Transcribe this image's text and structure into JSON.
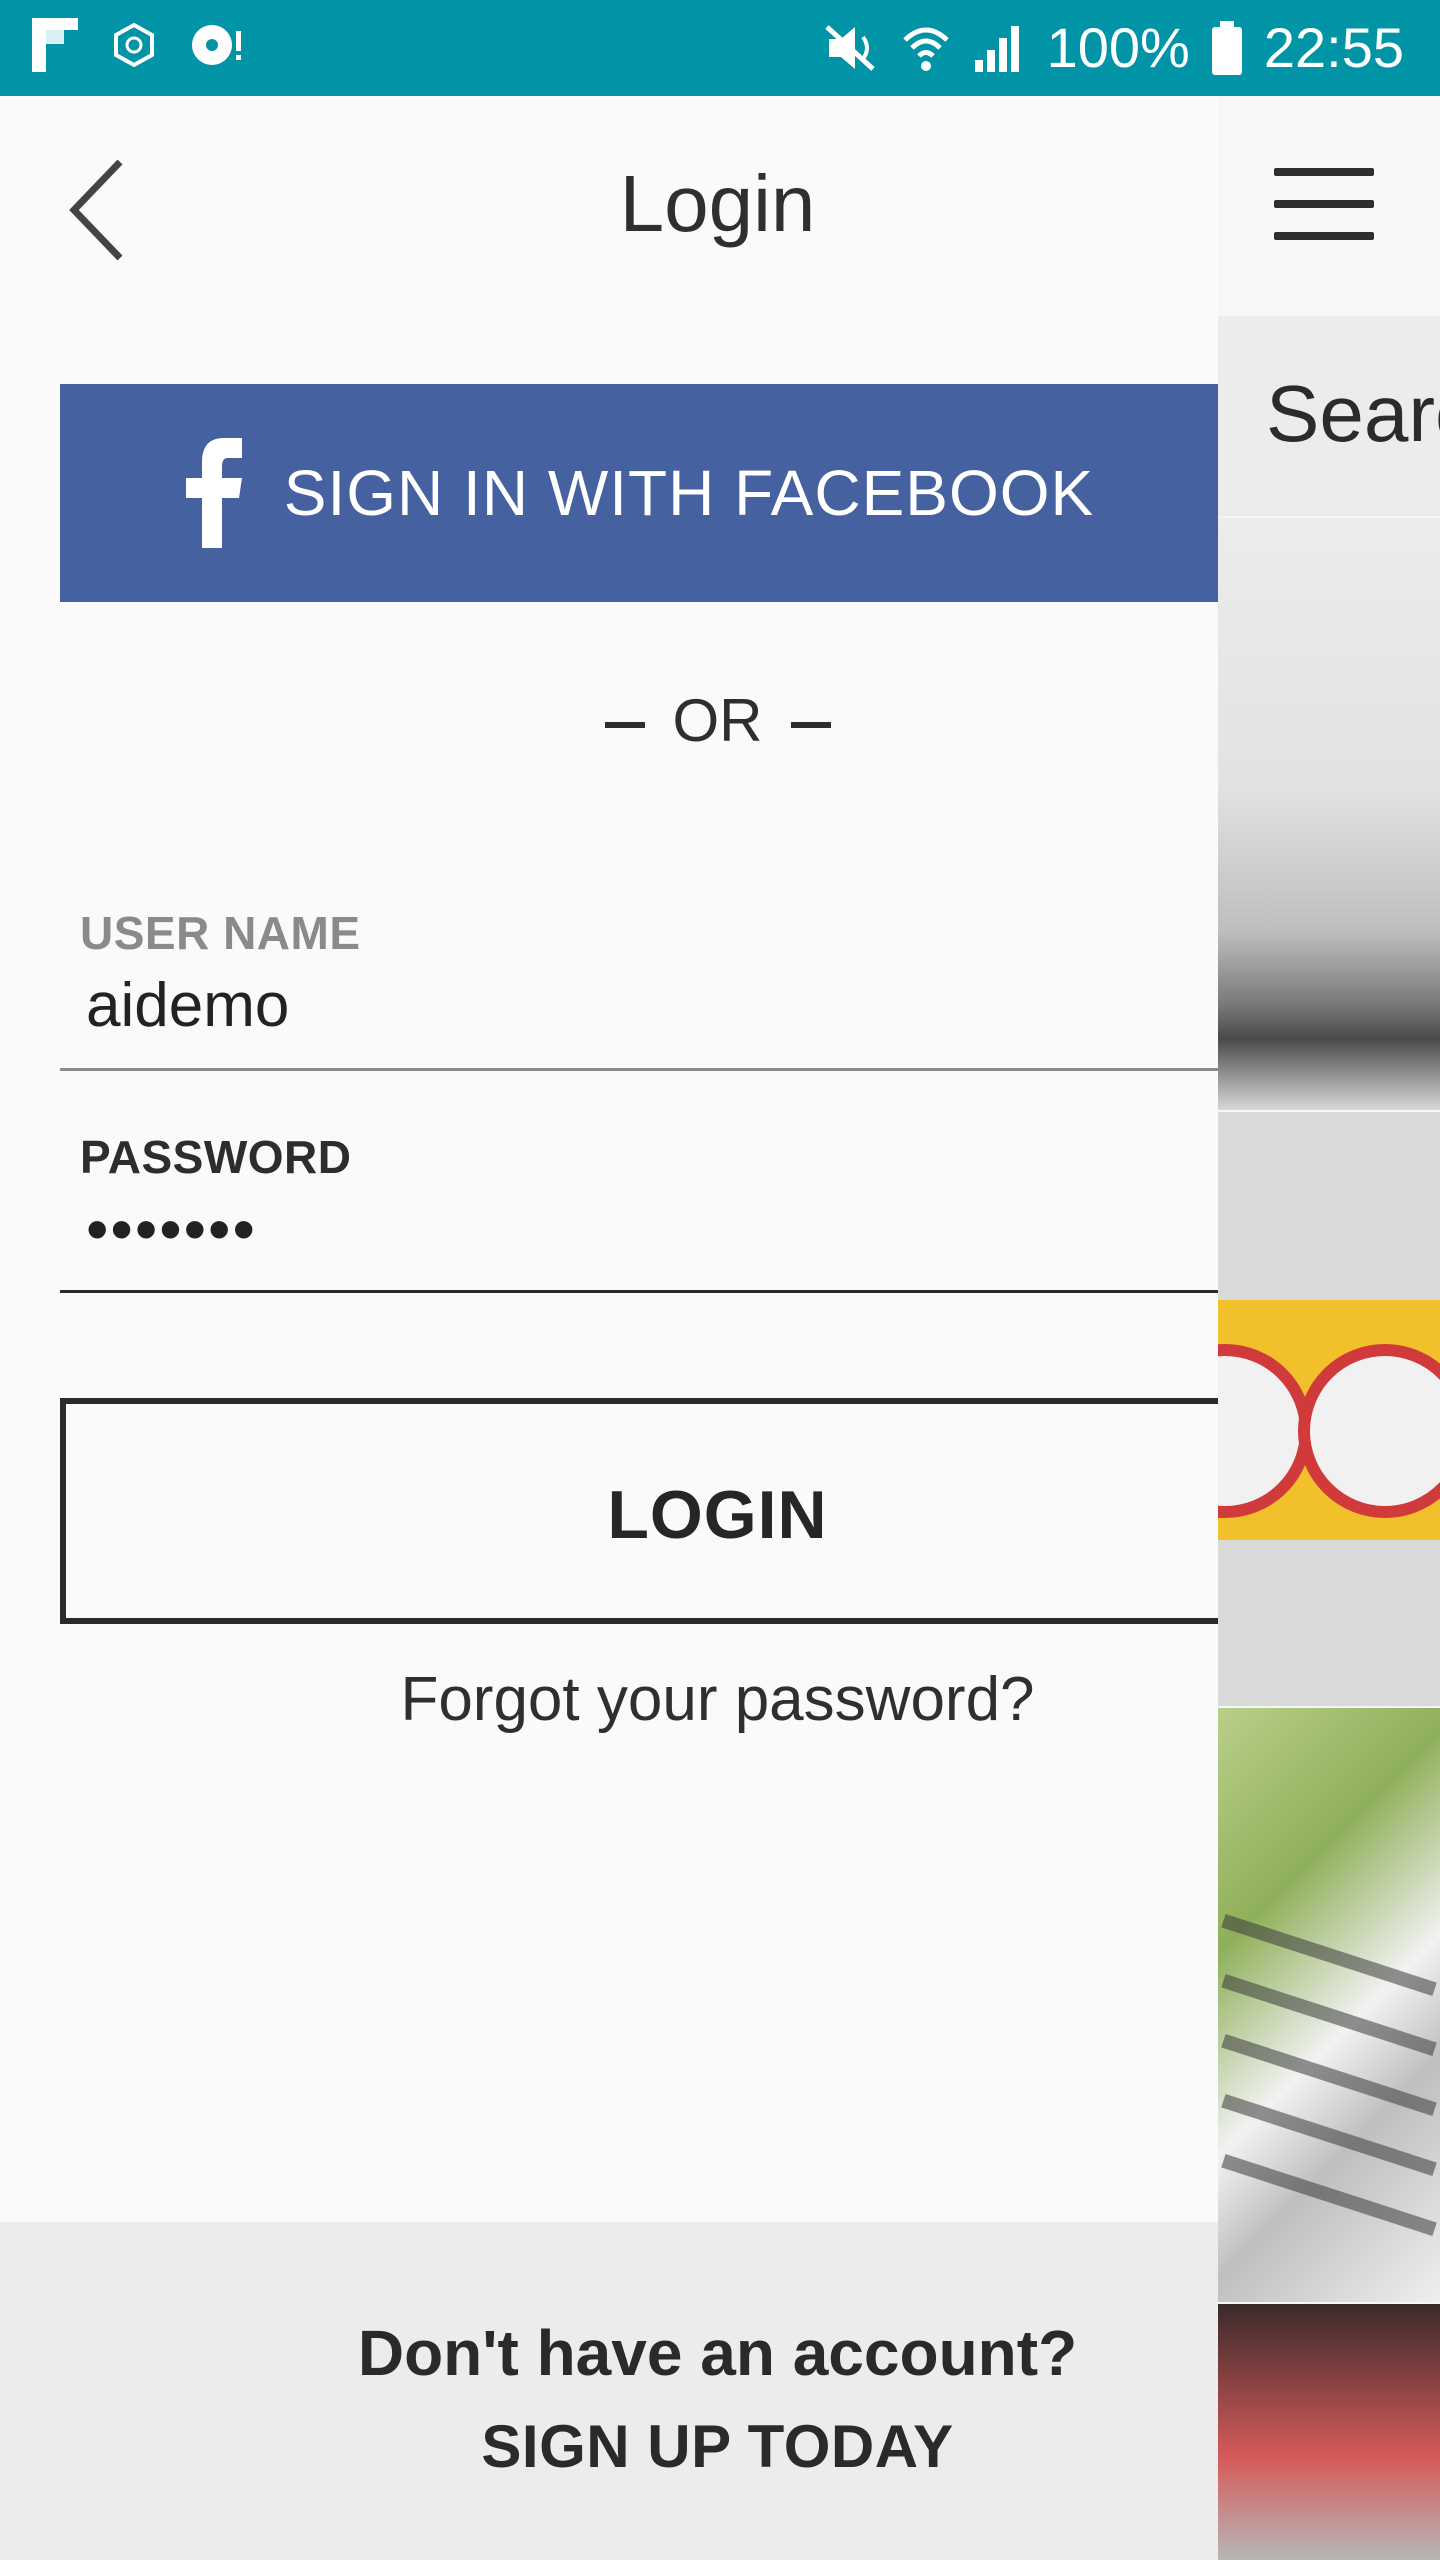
{
  "status_bar": {
    "battery": "100%",
    "time": "22:55"
  },
  "header": {
    "title": "Login"
  },
  "facebook": {
    "label": "SIGN IN WITH FACEBOOK",
    "color": "#4661a0"
  },
  "divider": {
    "label": "OR"
  },
  "form": {
    "username_label": "USER NAME",
    "username_value": "aidemo",
    "password_label": "PASSWORD",
    "password_value": "•••••••"
  },
  "login": {
    "label": "LOGIN"
  },
  "forgot": {
    "label": "Forgot your password?"
  },
  "footer": {
    "question": "Don't have an account?",
    "signup": "SIGN UP TODAY"
  },
  "background_page": {
    "search_text": "Searc"
  },
  "colors": {
    "status_bar": "#0094a6",
    "footer": "#ececec"
  }
}
